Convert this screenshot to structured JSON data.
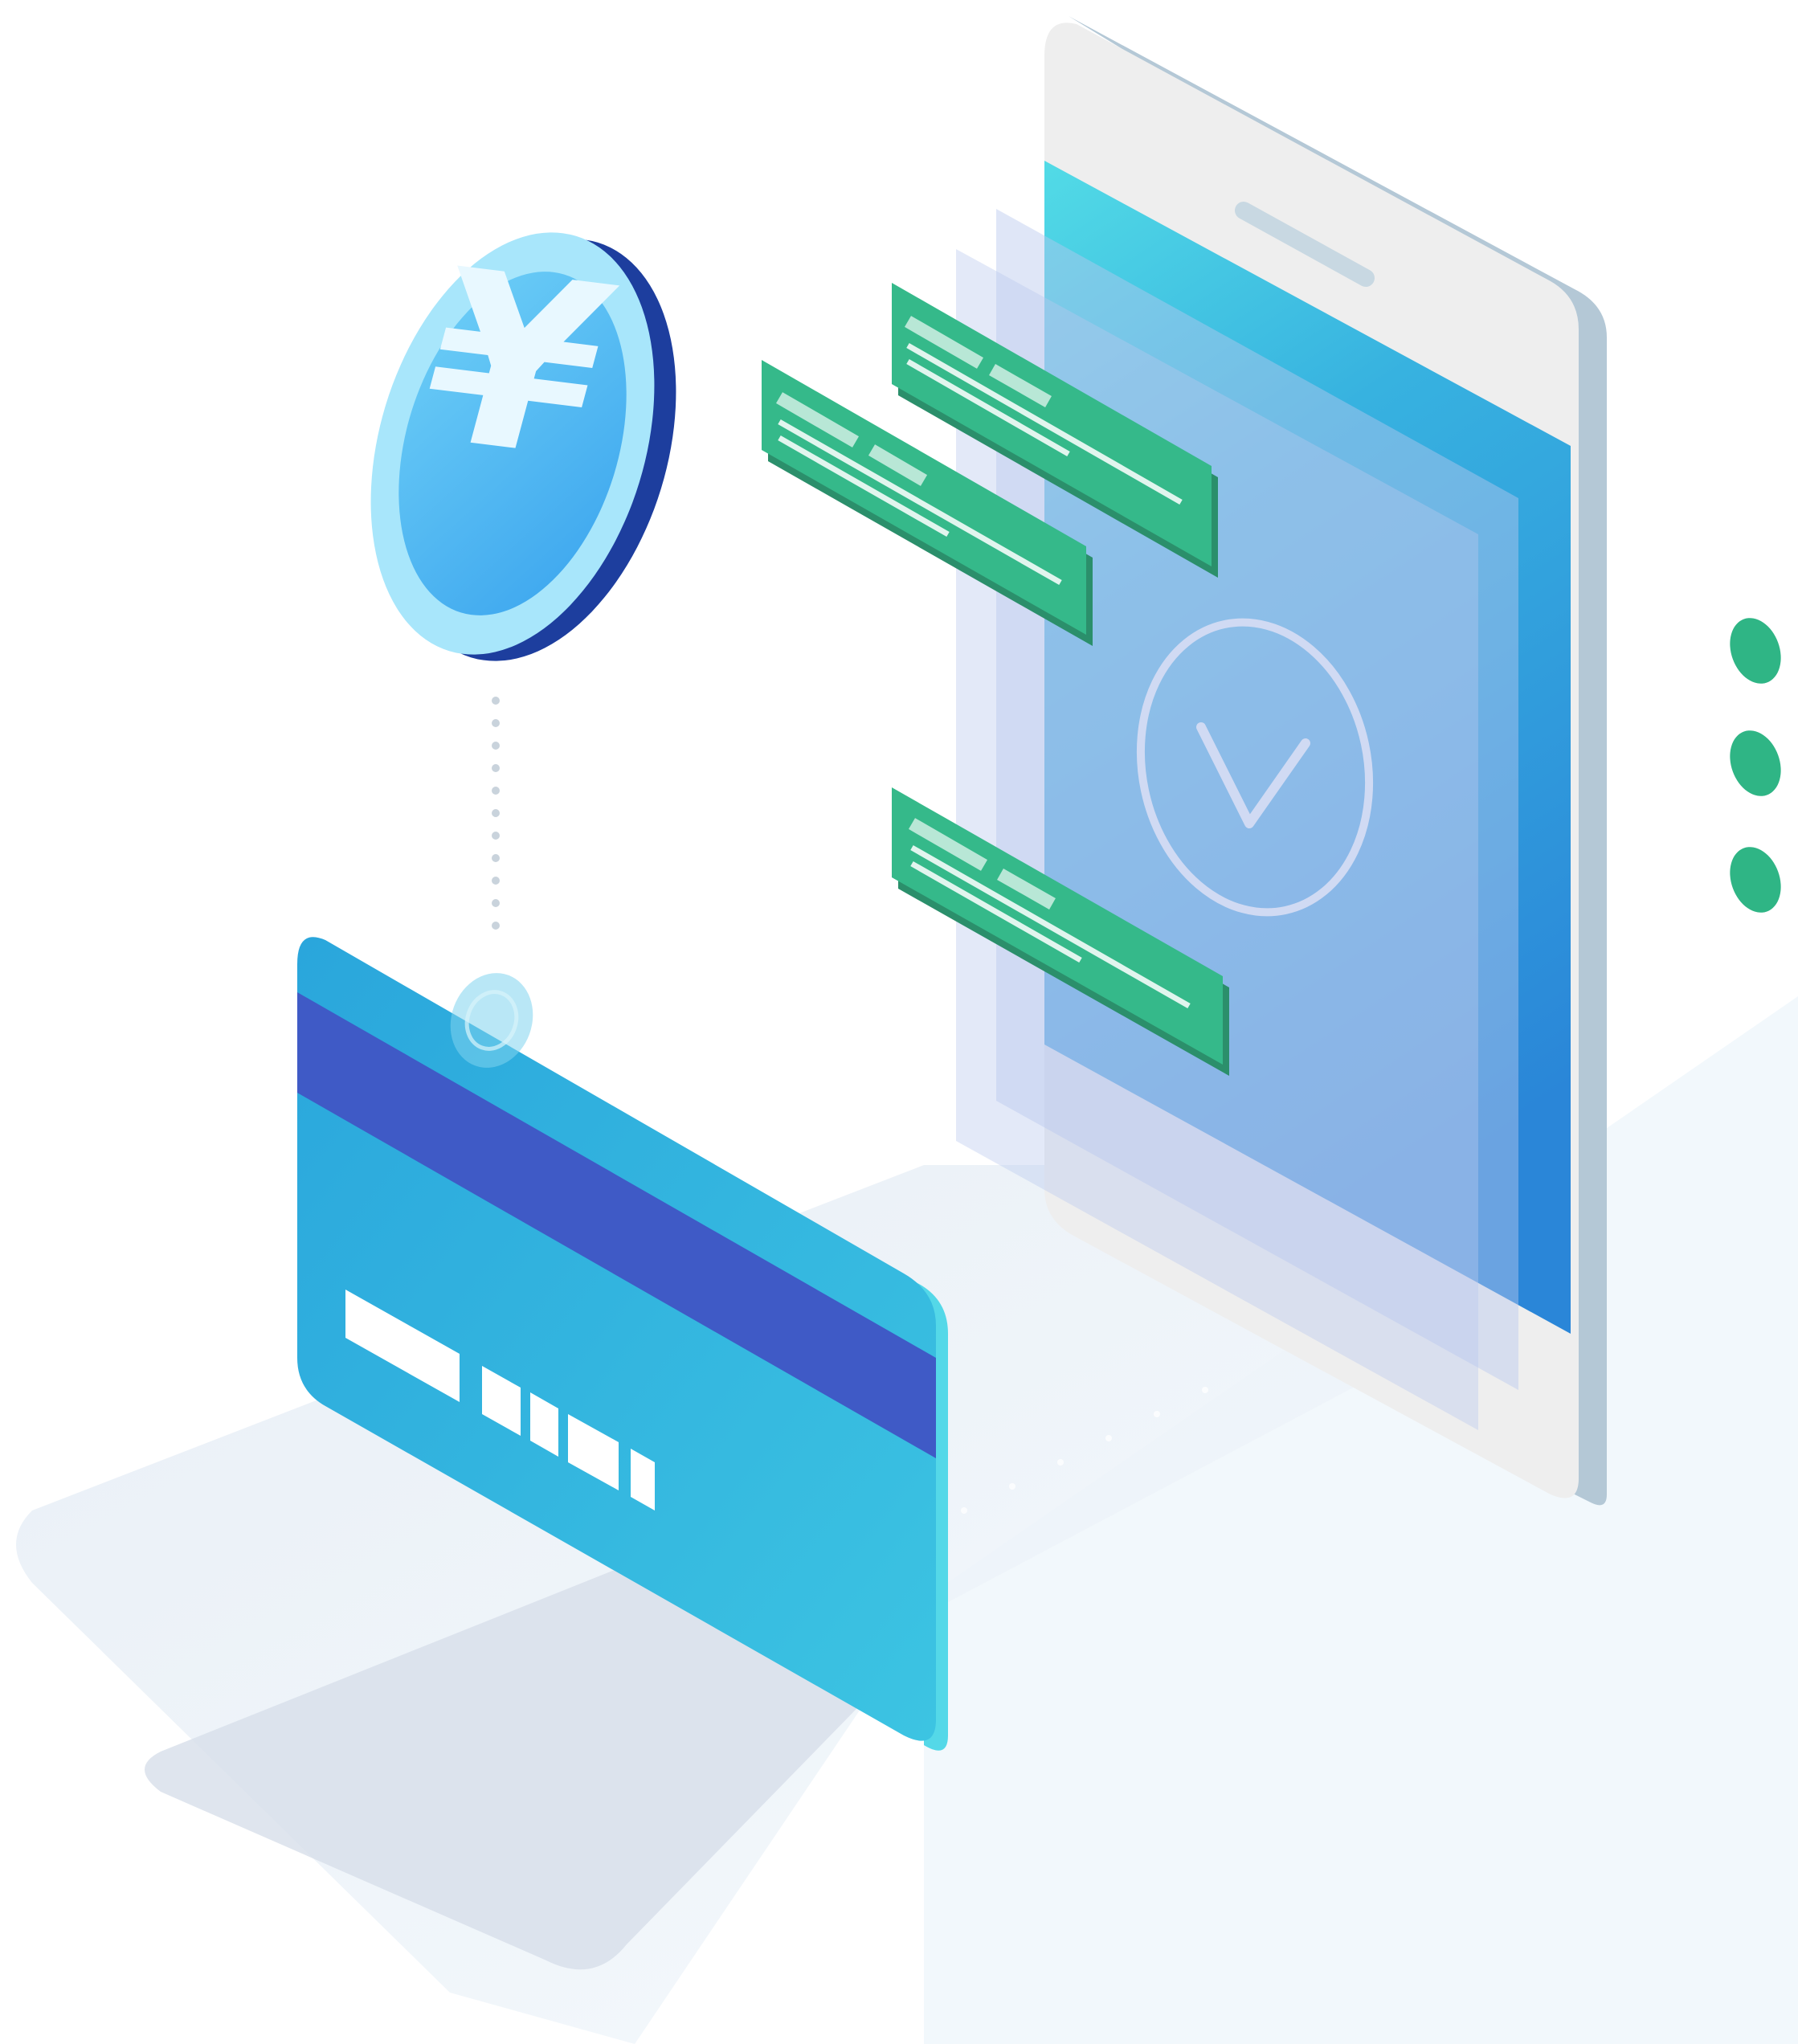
{
  "illustration": {
    "coin": {
      "symbol": "¥",
      "icon": "yen-coin-icon"
    },
    "phone": {
      "icon": "smartphone-icon",
      "status_icon": "checkmark-circle-icon"
    },
    "card": {
      "icon": "bank-card-icon"
    },
    "notifications": {
      "icon": "message-bubble-icon",
      "count": 3
    },
    "pager_dots": {
      "count": 3
    },
    "colors": {
      "background": "#ffffff",
      "floor": "#eef4fa",
      "coin_face": "#4fb7f2",
      "coin_rim": "#1d3e9e",
      "phone_frame": "#eeeeee",
      "phone_side": "#b4c8d6",
      "phone_screen_top": "#4fd9e6",
      "phone_screen_bottom": "#2a86d8",
      "card_body": "#35b2df",
      "card_stripe": "#3f5ac6",
      "bubble_green": "#35b98a",
      "dot_green": "#2fb585",
      "panel_lavender": "#b9c8ee"
    }
  }
}
